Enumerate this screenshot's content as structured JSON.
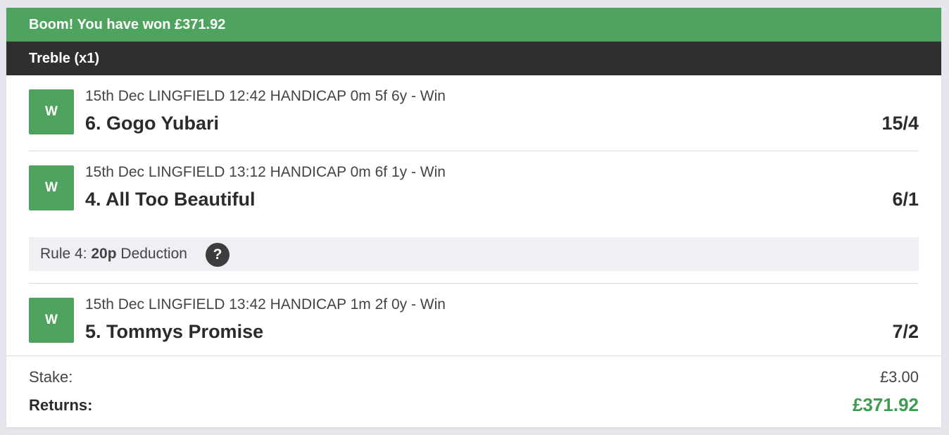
{
  "banner": {
    "text": "Boom! You have won £371.92",
    "color": "#4ea35e"
  },
  "bet": {
    "type_label": "Treble (x1)"
  },
  "legs": [
    {
      "result": "W",
      "meta": "15th Dec LINGFIELD 12:42 HANDICAP 0m 5f 6y - Win",
      "runner": "6. Gogo Yubari",
      "odds": "15/4"
    },
    {
      "result": "W",
      "meta": "15th Dec LINGFIELD 13:12 HANDICAP 0m 6f 1y - Win",
      "runner": "4. All Too Beautiful",
      "odds": "6/1",
      "rule4": {
        "prefix": "Rule 4: ",
        "amount": "20p",
        "suffix": " Deduction",
        "help": "?"
      }
    },
    {
      "result": "W",
      "meta": "15th Dec LINGFIELD 13:42 HANDICAP 1m 2f 0y - Win",
      "runner": "5. Tommys Promise",
      "odds": "7/2"
    }
  ],
  "summary": {
    "stake_label": "Stake:",
    "stake_value": "£3.00",
    "returns_label": "Returns:",
    "returns_value": "£371.92",
    "returns_color": "#3f9a52"
  }
}
